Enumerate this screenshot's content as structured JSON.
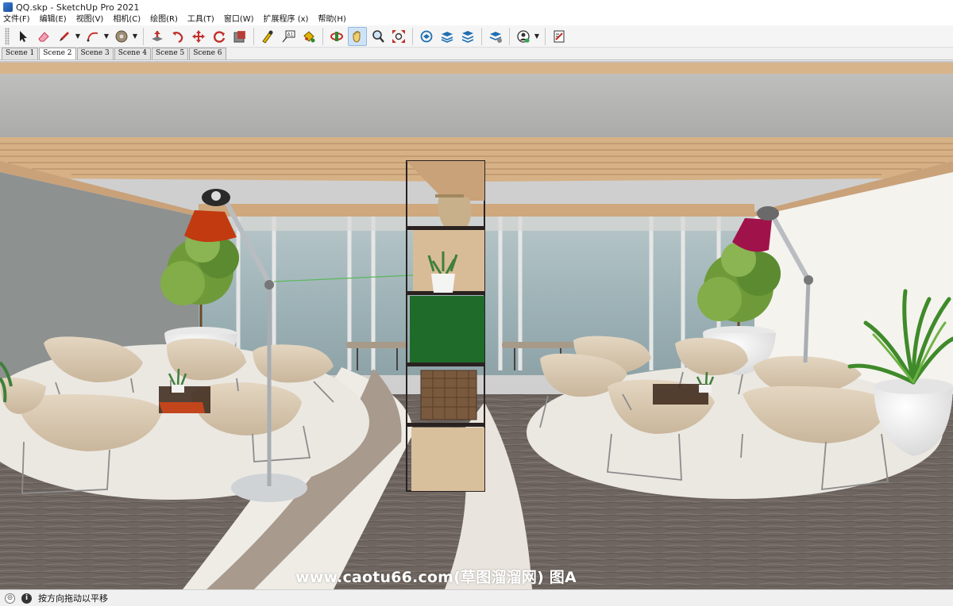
{
  "window": {
    "title": "QQ.skp - SketchUp Pro 2021"
  },
  "menu": {
    "items": [
      "文件(F)",
      "编辑(E)",
      "视图(V)",
      "相机(C)",
      "绘图(R)",
      "工具(T)",
      "窗口(W)",
      "扩展程序 (x)",
      "帮助(H)"
    ]
  },
  "toolbar": {
    "tools": [
      {
        "name": "select-tool-icon",
        "color": "#222222"
      },
      {
        "name": "eraser-tool-icon",
        "color": "#e0607a"
      },
      {
        "name": "pencil-line-tool-icon",
        "color": "#c0302a"
      },
      {
        "name": "arc-tool-icon",
        "color": "#c0302a"
      },
      {
        "name": "shapes-tool-icon",
        "color": "#8a7a60"
      },
      {
        "name": "push-pull-tool-icon",
        "color": "#c0302a"
      },
      {
        "name": "follow-me-tool-icon",
        "color": "#c0302a"
      },
      {
        "name": "move-tool-icon",
        "color": "#c0302a"
      },
      {
        "name": "rotate-tool-icon",
        "color": "#c0302a"
      },
      {
        "name": "scale-tool-icon",
        "color": "#c0302a"
      },
      {
        "name": "tape-measure-tool-icon",
        "color": "#d9a400"
      },
      {
        "name": "text-tool-icon",
        "color": "#333333"
      },
      {
        "name": "paint-bucket-tool-icon",
        "color": "#d9a400"
      },
      {
        "name": "orbit-tool-icon",
        "color": "#c0302a"
      },
      {
        "name": "pan-tool-icon",
        "color": "#d9a400"
      },
      {
        "name": "zoom-tool-icon",
        "color": "#333333"
      },
      {
        "name": "zoom-extents-tool-icon",
        "color": "#c0302a"
      },
      {
        "name": "3d-warehouse-icon",
        "color": "#1f6fb2"
      },
      {
        "name": "extension-warehouse-icon",
        "color": "#1f6fb2"
      },
      {
        "name": "send-to-layout-icon",
        "color": "#1f6fb2"
      },
      {
        "name": "extension-manager-icon",
        "color": "#1f6fb2"
      },
      {
        "name": "user-account-icon",
        "color": "#2fa84f"
      },
      {
        "name": "style-builder-icon",
        "color": "#c0302a"
      }
    ]
  },
  "scenes": {
    "tabs": [
      "Scene 1",
      "Scene 2",
      "Scene 3",
      "Scene 4",
      "Scene 5",
      "Scene 6"
    ],
    "active": "Scene 2"
  },
  "viewport": {
    "watermark": "www.caotu66.com(草图溜溜网) 图A",
    "colors": {
      "ceiling": "#b9b9b7",
      "wood_beam": "#d9b98e",
      "floor_wood": "#6e6560",
      "rug": "#e9e7e1",
      "chair": "#d9c7ae",
      "lamp_left_shade": "#c23a10",
      "lamp_right_shade": "#a0124a",
      "shelf_green": "#1e6b2a",
      "glass": "#9bb2b6"
    }
  },
  "status": {
    "text": "按方向拖动以平移"
  }
}
